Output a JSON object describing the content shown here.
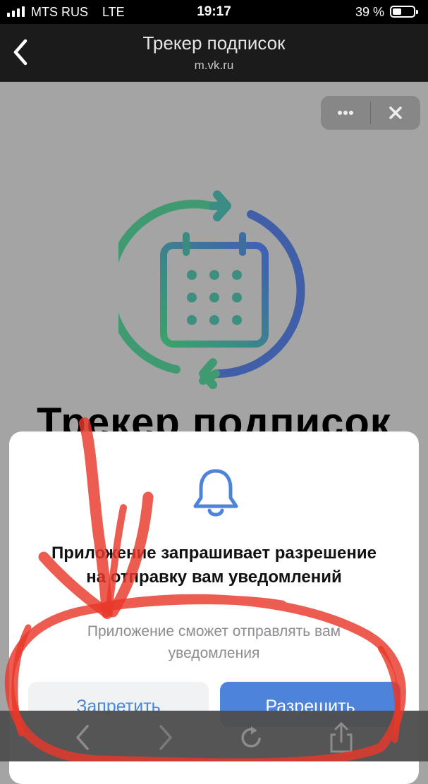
{
  "status_bar": {
    "carrier": "MTS RUS",
    "network": "LTE",
    "time": "19:17",
    "battery_percent": "39 %",
    "battery_level": 0.39,
    "signal_bars": 4
  },
  "header": {
    "title": "Трекер подписок",
    "subtitle": "m.vk.ru",
    "back_icon": "chevron-left-icon"
  },
  "miniapp_controls": {
    "more_icon": "more-dots-icon",
    "close_icon": "close-icon"
  },
  "app": {
    "heading": "Трекер подписок",
    "logo_icon": "calendar-refresh-icon"
  },
  "dialog": {
    "icon": "bell-icon",
    "title": "Приложение запрашивает разрешение на отправку вам уведомлений",
    "text": "Приложение сможет отправлять вам уведомления",
    "deny_label": "Запретить",
    "allow_label": "Разрешить"
  },
  "toolbar": {
    "back_icon": "arrow-back-icon",
    "forward_icon": "arrow-forward-icon",
    "reload_icon": "reload-icon",
    "share_icon": "share-icon"
  },
  "colors": {
    "accent_blue": "#4d83d8",
    "logo_green": "#3aa36a",
    "logo_blue": "#3f5fb5",
    "scribble_red": "#e8382a"
  }
}
